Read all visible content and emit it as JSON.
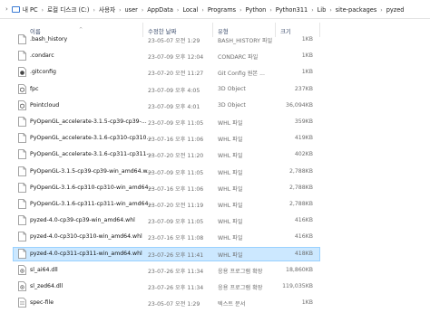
{
  "breadcrumb": [
    "내 PC",
    "로컬 디스크 (C:)",
    "사용자",
    "user",
    "AppData",
    "Local",
    "Programs",
    "Python",
    "Python311",
    "Lib",
    "site-packages",
    "pyzed"
  ],
  "columns": {
    "name": "이름",
    "date": "수정한 날짜",
    "type": "유형",
    "size": "크기"
  },
  "files": [
    {
      "name": ".bash_history",
      "date": "23-05-07 오전 1:29",
      "type": "BASH_HISTORY 파일",
      "size": "1KB",
      "icon": "generic-file-icon",
      "selected": false
    },
    {
      "name": ".condarc",
      "date": "23-07-09 오후 12:04",
      "type": "CONDARC 파일",
      "size": "1KB",
      "icon": "generic-file-icon",
      "selected": false
    },
    {
      "name": ".gitconfig",
      "date": "23-07-20 오전 11:27",
      "type": "Git Config 원본 ...",
      "size": "1KB",
      "icon": "git-config-icon",
      "selected": false
    },
    {
      "name": "fpc",
      "date": "23-07-09 오후 4:05",
      "type": "3D Object",
      "size": "237KB",
      "icon": "3d-object-icon",
      "selected": false
    },
    {
      "name": "Pointcloud",
      "date": "23-07-09 오후 4:01",
      "type": "3D Object",
      "size": "36,094KB",
      "icon": "3d-object-icon",
      "selected": false
    },
    {
      "name": "PyOpenGL_accelerate-3.1.5-cp39-cp39-...",
      "date": "23-07-09 오후 11:05",
      "type": "WHL 파일",
      "size": "359KB",
      "icon": "generic-file-icon",
      "selected": false
    },
    {
      "name": "PyOpenGL_accelerate-3.1.6-cp310-cp310...",
      "date": "23-07-16 오후 11:06",
      "type": "WHL 파일",
      "size": "419KB",
      "icon": "generic-file-icon",
      "selected": false
    },
    {
      "name": "PyOpenGL_accelerate-3.1.6-cp311-cp311-...",
      "date": "23-07-20 오전 11:20",
      "type": "WHL 파일",
      "size": "402KB",
      "icon": "generic-file-icon",
      "selected": false
    },
    {
      "name": "PyOpenGL-3.1.5-cp39-cp39-win_amd64.w...",
      "date": "23-07-09 오후 11:05",
      "type": "WHL 파일",
      "size": "2,788KB",
      "icon": "generic-file-icon",
      "selected": false
    },
    {
      "name": "PyOpenGL-3.1.6-cp310-cp310-win_amd64...",
      "date": "23-07-16 오후 11:06",
      "type": "WHL 파일",
      "size": "2,788KB",
      "icon": "generic-file-icon",
      "selected": false
    },
    {
      "name": "PyOpenGL-3.1.6-cp311-cp311-win_amd64...",
      "date": "23-07-20 오전 11:19",
      "type": "WHL 파일",
      "size": "2,788KB",
      "icon": "generic-file-icon",
      "selected": false
    },
    {
      "name": "pyzed-4.0-cp39-cp39-win_amd64.whl",
      "date": "23-07-09 오후 11:05",
      "type": "WHL 파일",
      "size": "416KB",
      "icon": "generic-file-icon",
      "selected": false
    },
    {
      "name": "pyzed-4.0-cp310-cp310-win_amd64.whl",
      "date": "23-07-16 오후 11:08",
      "type": "WHL 파일",
      "size": "416KB",
      "icon": "generic-file-icon",
      "selected": false
    },
    {
      "name": "pyzed-4.0-cp311-cp311-win_amd64.whl",
      "date": "23-07-26 오후 11:41",
      "type": "WHL 파일",
      "size": "418KB",
      "icon": "generic-file-icon",
      "selected": true
    },
    {
      "name": "sl_ai64.dll",
      "date": "23-07-26 오후 11:34",
      "type": "응용 프로그램 확장",
      "size": "18,860KB",
      "icon": "dll-file-icon",
      "selected": false
    },
    {
      "name": "sl_zed64.dll",
      "date": "23-07-26 오후 11:34",
      "type": "응용 프로그램 확장",
      "size": "119,035KB",
      "icon": "dll-file-icon",
      "selected": false
    },
    {
      "name": "spec-file",
      "date": "23-05-07 오전 1:29",
      "type": "텍스트 문서",
      "size": "1KB",
      "icon": "text-file-icon",
      "selected": false
    }
  ]
}
